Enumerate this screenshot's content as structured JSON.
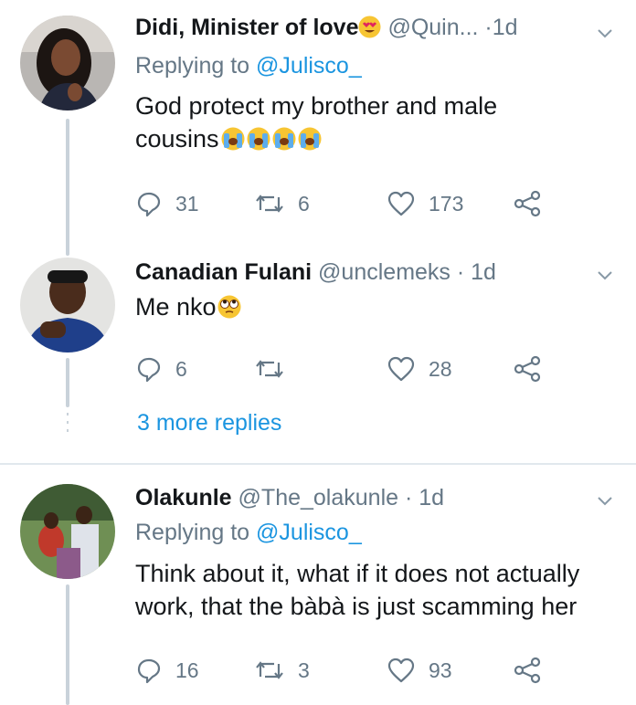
{
  "tweets": [
    {
      "name": "Didi, Minister of love",
      "name_emoji": "heart-eyes-emoji",
      "handle": "@Quin...",
      "separator": "·",
      "time": "1d",
      "replying_prefix": "Replying to",
      "replying_handle": "@Julisco_",
      "text_lines": [
        "God protect my brother and male",
        "cousins"
      ],
      "text_emoji": "loudly-crying-emoji",
      "replies": "31",
      "retweets": "6",
      "likes": "173"
    },
    {
      "name": "Canadian Fulani",
      "handle": "@unclemeks",
      "separator": "·",
      "time": "1d",
      "text": "Me nko",
      "text_emoji": "eye-roll-emoji",
      "replies": "6",
      "retweets": "",
      "likes": "28"
    },
    {
      "name": "Olakunle",
      "handle": "@The_olakunle",
      "separator": "·",
      "time": "1d",
      "replying_prefix": "Replying to",
      "replying_handle": "@Julisco_",
      "text_lines": [
        "Think about it, what if it does not actually",
        "work, that the bàbà is just scamming her"
      ],
      "replies": "16",
      "retweets": "3",
      "likes": "93"
    }
  ],
  "more_replies": "3 more replies",
  "colors": {
    "link": "#1b95e0",
    "muted": "#657786",
    "line": "#c9d2da",
    "divider": "#e1e8ed"
  }
}
